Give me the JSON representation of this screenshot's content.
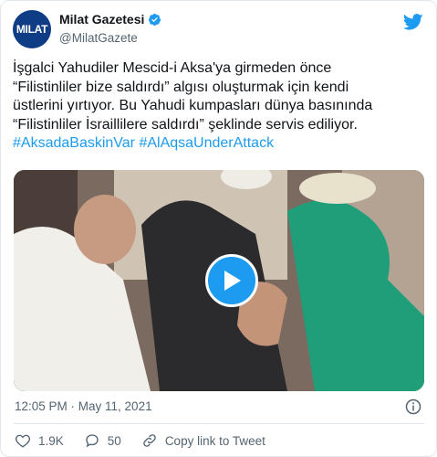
{
  "account": {
    "display_name": "Milat Gazetesi",
    "handle": "@MilatGazete",
    "avatar_text": "MILAT"
  },
  "tweet": {
    "body": "İşgalci Yahudiler Mescid-i Aksa'ya girmeden önce\n“Filistinliler bize saldırdı” algısı oluşturmak için kendi\nüstlerini yırtıyor. Bu Yahudi kumpasları dünya basınında\n“Filistinliler İsraillilere saldırdı” şeklinde servis ediliyor.",
    "hashtags": "#AksadaBaskinVar #AlAqsaUnderAttack",
    "timestamp": "12:05 PM · May 11, 2021"
  },
  "actions": {
    "likes": "1.9K",
    "replies": "50",
    "share_label": "Copy link to Tweet"
  },
  "colors": {
    "accent": "#1d9bf0",
    "avatar_bg": "#0e3d86"
  },
  "icons": [
    "verified-icon",
    "twitter-bird-icon",
    "play-icon",
    "info-icon",
    "heart-icon",
    "reply-icon",
    "link-icon"
  ]
}
